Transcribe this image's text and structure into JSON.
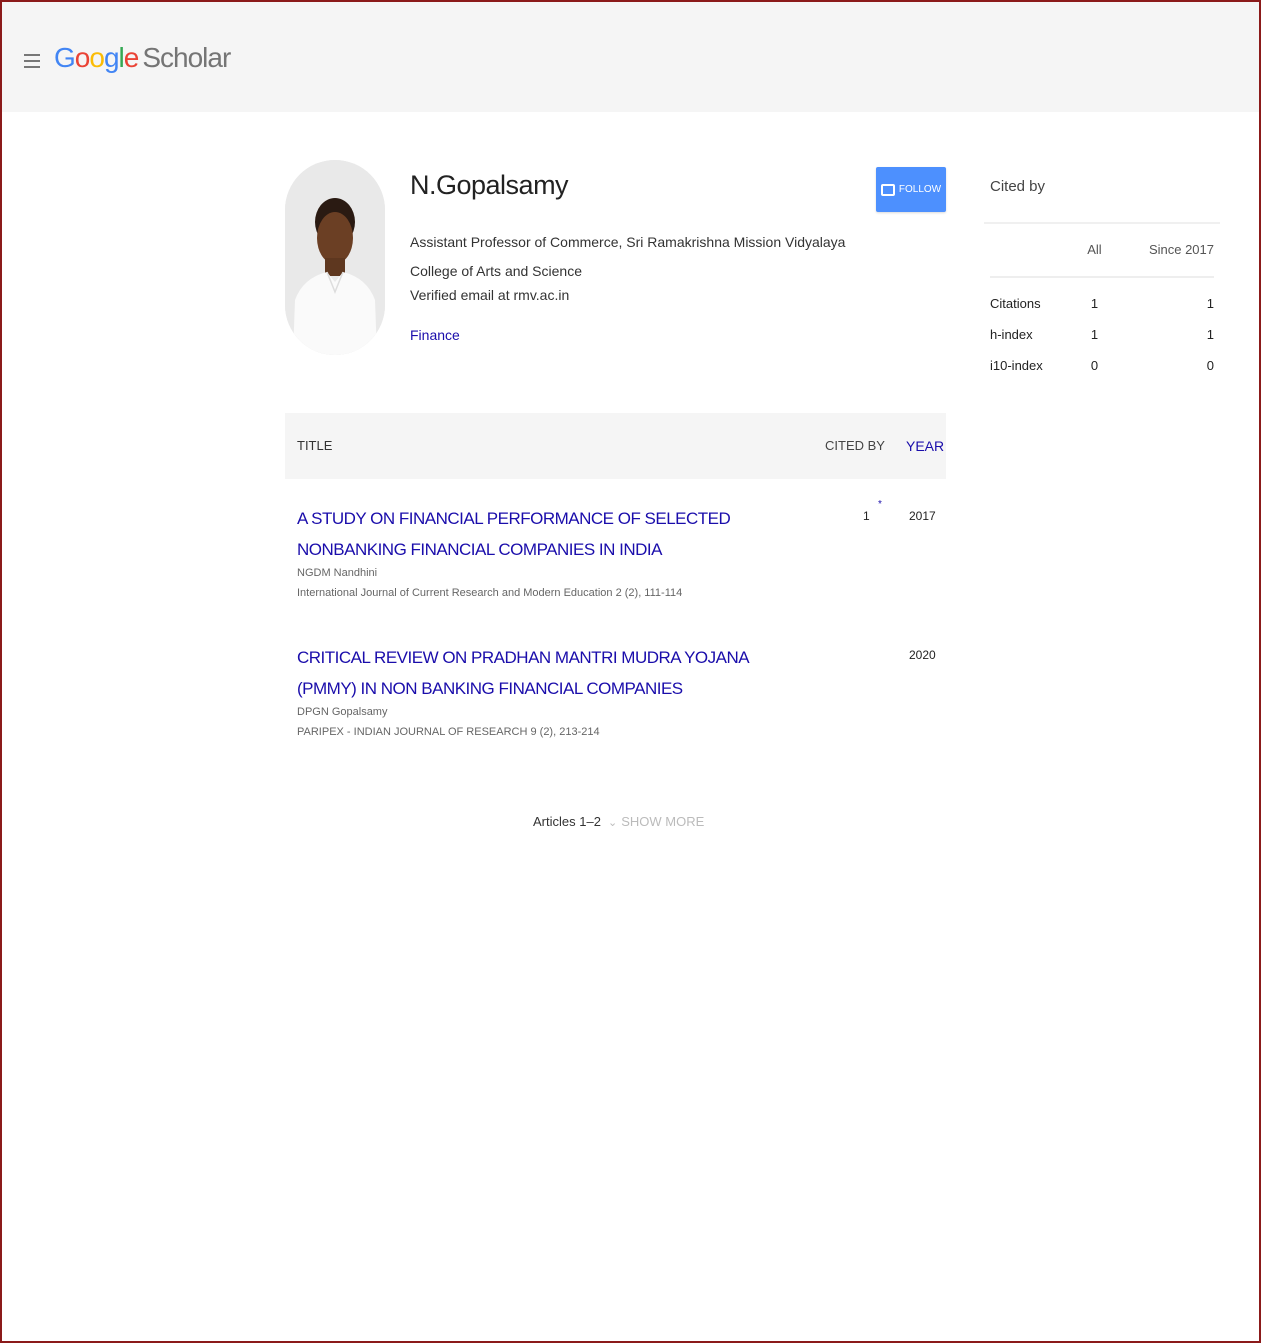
{
  "app": {
    "logo_google": "Google",
    "logo_scholar": "Scholar"
  },
  "profile": {
    "name": "N.Gopalsamy",
    "affiliation": "Assistant Professor of Commerce, Sri Ramakrishna Mission Vidyalaya College of Arts and Science",
    "email": "Verified email at rmv.ac.in",
    "interests": [
      "Finance"
    ],
    "follow_label": "FOLLOW"
  },
  "cited_by": {
    "title": "Cited by",
    "columns": [
      "All",
      "Since 2017"
    ],
    "rows": [
      {
        "label": "Citations",
        "all": "1",
        "since": "1"
      },
      {
        "label": "h-index",
        "all": "1",
        "since": "1"
      },
      {
        "label": "i10-index",
        "all": "0",
        "since": "0"
      }
    ]
  },
  "articles_header": {
    "title": "TITLE",
    "cited_by": "CITED BY",
    "year": "YEAR"
  },
  "articles": [
    {
      "title": "A STUDY ON FINANCIAL PERFORMANCE OF SELECTED NONBANKING FINANCIAL COMPANIES IN INDIA",
      "authors": "NGDM Nandhini",
      "venue": "International Journal of Current Research and Modern Education 2 (2), 111-114",
      "cited_by": "1",
      "star": "*",
      "year": "2017"
    },
    {
      "title": "CRITICAL REVIEW ON PRADHAN MANTRI MUDRA YOJANA (PMMY) IN NON BANKING FINANCIAL COMPANIES",
      "authors": "DPGN Gopalsamy",
      "venue": "PARIPEX - INDIAN JOURNAL OF RESEARCH 9 (2), 213-214",
      "cited_by": "",
      "star": "",
      "year": "2020"
    }
  ],
  "pagination": {
    "count_label": "Articles 1–2",
    "show_more_label": "SHOW MORE"
  },
  "colors": {
    "link": "#1a0dab",
    "follow_button": "#4d90fe",
    "topbar": "#f5f5f5",
    "frame": "#8b1a1a"
  },
  "icons": {
    "menu": "hamburger-icon",
    "follow": "follow-icon",
    "show_more": "chevron-down-icon"
  }
}
